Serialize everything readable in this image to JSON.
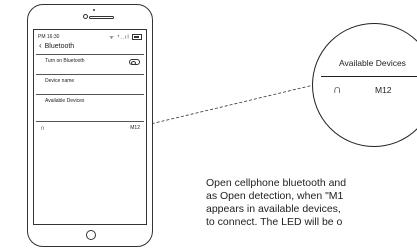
{
  "status_bar": {
    "time": "PM 16:30",
    "wifi_icon": "wifi-icon",
    "signal": "ᵀ..ıl"
  },
  "screen": {
    "title": "Bluetooth",
    "back_glyph": "‹",
    "rows": {
      "turn_on": "Turn on Bluetooth",
      "device_name": "Device name",
      "available": "Available   Devices"
    },
    "device": {
      "icon": "headphones-icon",
      "name": "M12"
    }
  },
  "zoom": {
    "title": "Available Devices",
    "device_icon": "headphones-icon",
    "device_name": "M12"
  },
  "caption_lines": [
    "Open cellphone bluetooth and",
    "as Open detection, when \"M1",
    "appears in available devices,",
    "to connect. The LED will be o"
  ]
}
